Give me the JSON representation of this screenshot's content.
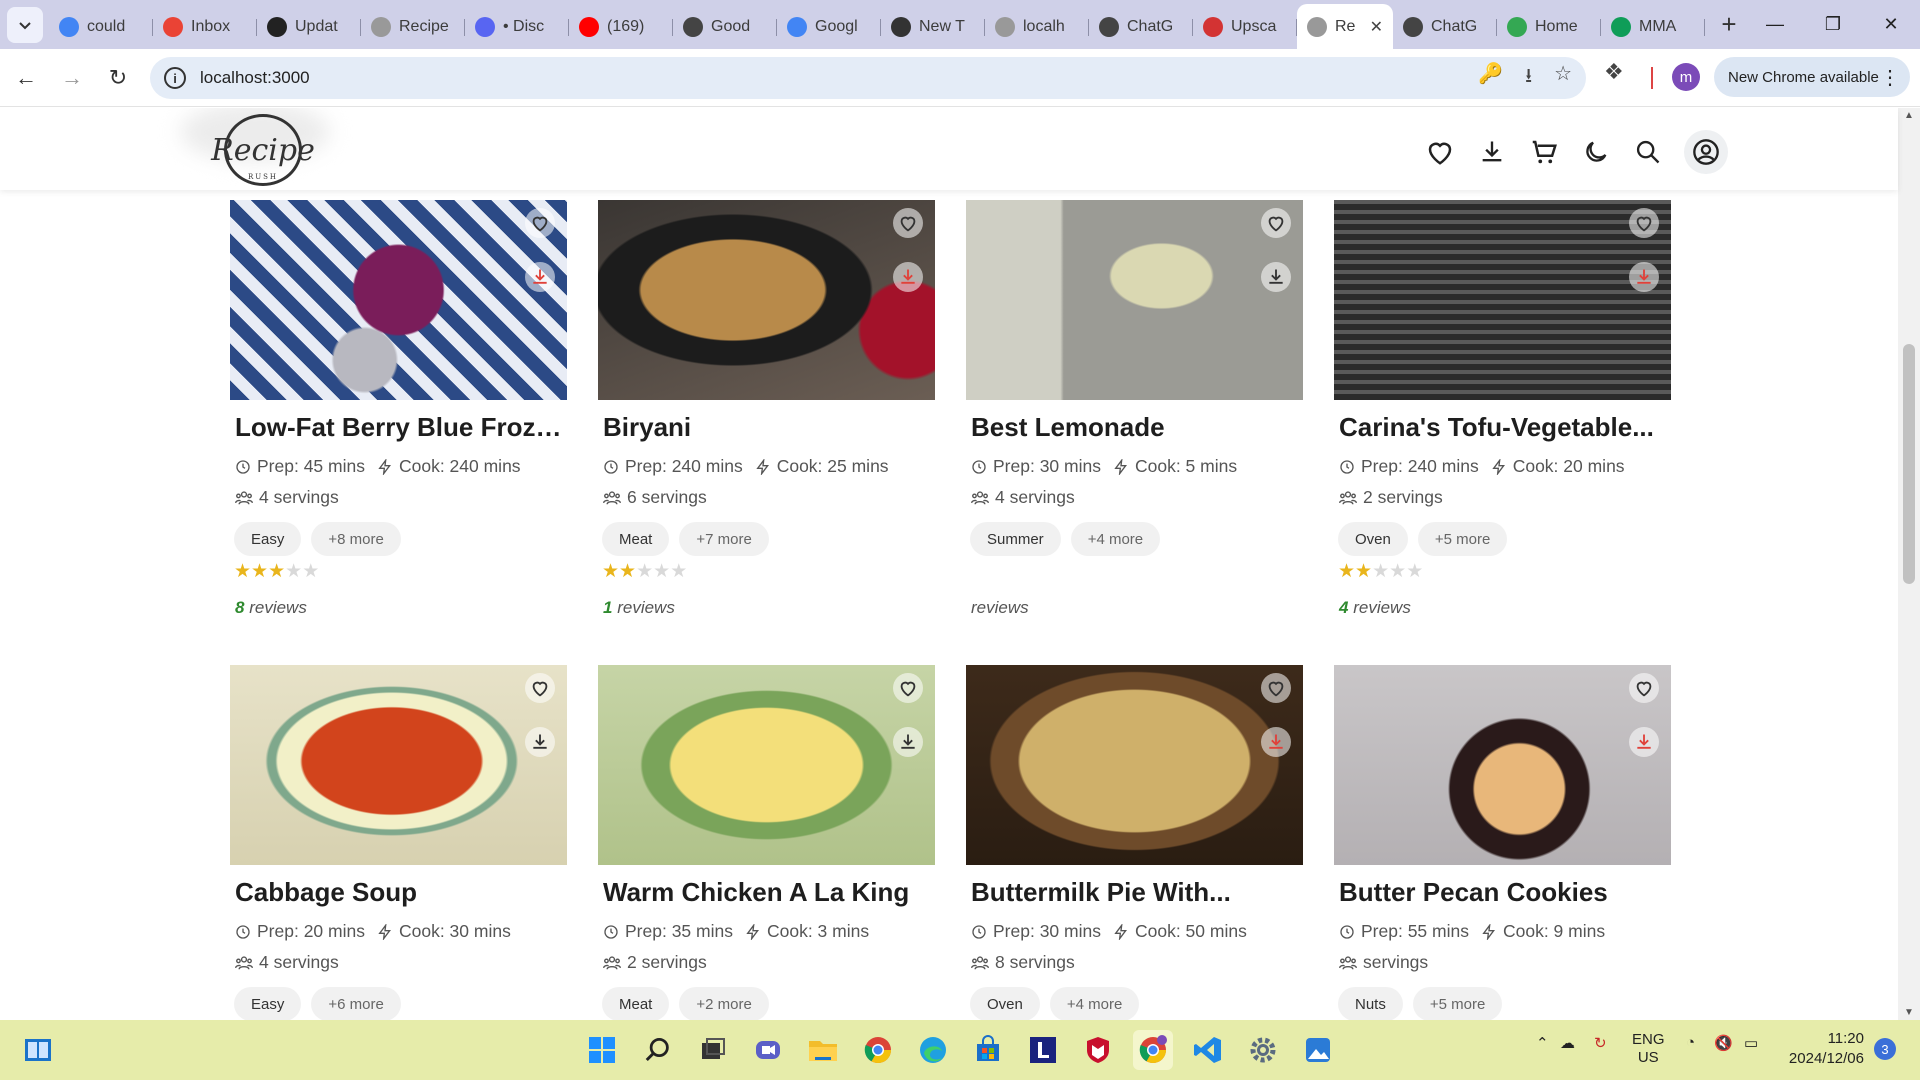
{
  "browser": {
    "tabs": [
      {
        "label": "could",
        "favicon": "google-icon",
        "color": "#4285f4"
      },
      {
        "label": "Inbox",
        "favicon": "gmail-icon",
        "color": "#ea4335"
      },
      {
        "label": "Updat",
        "favicon": "github-icon",
        "color": "#222222"
      },
      {
        "label": "Recipe",
        "favicon": "openai-icon",
        "color": "#999999"
      },
      {
        "label": "• Disc",
        "favicon": "discord-icon",
        "color": "#5865f2"
      },
      {
        "label": "(169)",
        "favicon": "youtube-icon",
        "color": "#ff0000"
      },
      {
        "label": "Good",
        "favicon": "openai-icon",
        "color": "#444444"
      },
      {
        "label": "Googl",
        "favicon": "google-slides-icon",
        "color": "#4285f4"
      },
      {
        "label": "New T",
        "favicon": "chrome-icon",
        "color": "#333333"
      },
      {
        "label": "localh",
        "favicon": "openai-icon",
        "color": "#999999"
      },
      {
        "label": "ChatG",
        "favicon": "openai-icon",
        "color": "#444444"
      },
      {
        "label": "Upsca",
        "favicon": "p-icon",
        "color": "#d33333"
      },
      {
        "label": "Re",
        "favicon": "openai-icon",
        "color": "#999999",
        "active": true
      },
      {
        "label": "ChatG",
        "favicon": "openai-icon",
        "color": "#444444"
      },
      {
        "label": "Home",
        "favicon": "drive-icon",
        "color": "#34a853"
      },
      {
        "label": "MMA",
        "favicon": "sheets-icon",
        "color": "#0f9d58"
      }
    ],
    "url": "localhost:3000",
    "new_chrome_label": "New Chrome available",
    "profile_initial": "m"
  },
  "site": {
    "logo_text": "Recipe",
    "logo_sub": "RUSH"
  },
  "recipes": [
    {
      "title": "Low-Fat Berry Blue Froze...",
      "prep": "Prep: 45 mins",
      "cook": "Cook: 240 mins",
      "servings": "4 servings",
      "tag": "Easy",
      "more": "+8 more",
      "rating": 3,
      "reviews_count": "8",
      "reviews_label": "reviews",
      "photo": "berry-sorbet",
      "dl_red": true
    },
    {
      "title": "Biryani",
      "prep": "Prep: 240 mins",
      "cook": "Cook: 25 mins",
      "servings": "6 servings",
      "tag": "Meat",
      "more": "+7 more",
      "rating": 2,
      "reviews_count": "1",
      "reviews_label": "reviews",
      "photo": "biryani",
      "dl_red": true
    },
    {
      "title": "Best Lemonade",
      "prep": "Prep: 30 mins",
      "cook": "Cook: 5 mins",
      "servings": "4 servings",
      "tag": "Summer",
      "more": "+4 more",
      "rating": 0,
      "reviews_count": "",
      "reviews_label": "reviews",
      "photo": "lemonade",
      "dl_red": false
    },
    {
      "title": "Carina's Tofu-Vegetable...",
      "prep": "Prep: 240 mins",
      "cook": "Cook: 20 mins",
      "servings": "2 servings",
      "tag": "Oven",
      "more": "+5 more",
      "rating": 2,
      "reviews_count": "4",
      "reviews_label": "reviews",
      "photo": "kebabs",
      "dl_red": true
    },
    {
      "title": "Cabbage Soup",
      "prep": "Prep: 20 mins",
      "cook": "Cook: 30 mins",
      "servings": "4 servings",
      "tag": "Easy",
      "more": "+6 more",
      "rating": 0,
      "reviews_count": "",
      "reviews_label": "",
      "photo": "soup",
      "dl_red": false
    },
    {
      "title": "Warm Chicken A La King",
      "prep": "Prep: 35 mins",
      "cook": "Cook: 3 mins",
      "servings": "2 servings",
      "tag": "Meat",
      "more": "+2 more",
      "rating": 0,
      "reviews_count": "",
      "reviews_label": "",
      "photo": "chicken",
      "dl_red": false
    },
    {
      "title": "Buttermilk Pie With...",
      "prep": "Prep: 30 mins",
      "cook": "Cook: 50 mins",
      "servings": "8 servings",
      "tag": "Oven",
      "more": "+4 more",
      "rating": 0,
      "reviews_count": "",
      "reviews_label": "",
      "photo": "pie",
      "dl_red": true
    },
    {
      "title": "Butter Pecan Cookies",
      "prep": "Prep: 55 mins",
      "cook": "Cook: 9 mins",
      "servings": "servings",
      "tag": "Nuts",
      "more": "+5 more",
      "rating": 0,
      "reviews_count": "",
      "reviews_label": "",
      "photo": "cookies",
      "dl_red": true
    }
  ],
  "taskbar": {
    "lang": "ENG",
    "region": "US",
    "time": "11:20",
    "date": "2024/12/06",
    "notifications": "3"
  },
  "colors": {
    "accent_red": "#e0413a",
    "star": "#e9b51c",
    "reviews_green": "#2f8a2f",
    "tab_strip": "#cfd0e8",
    "taskbar": "#e6ecaa"
  }
}
